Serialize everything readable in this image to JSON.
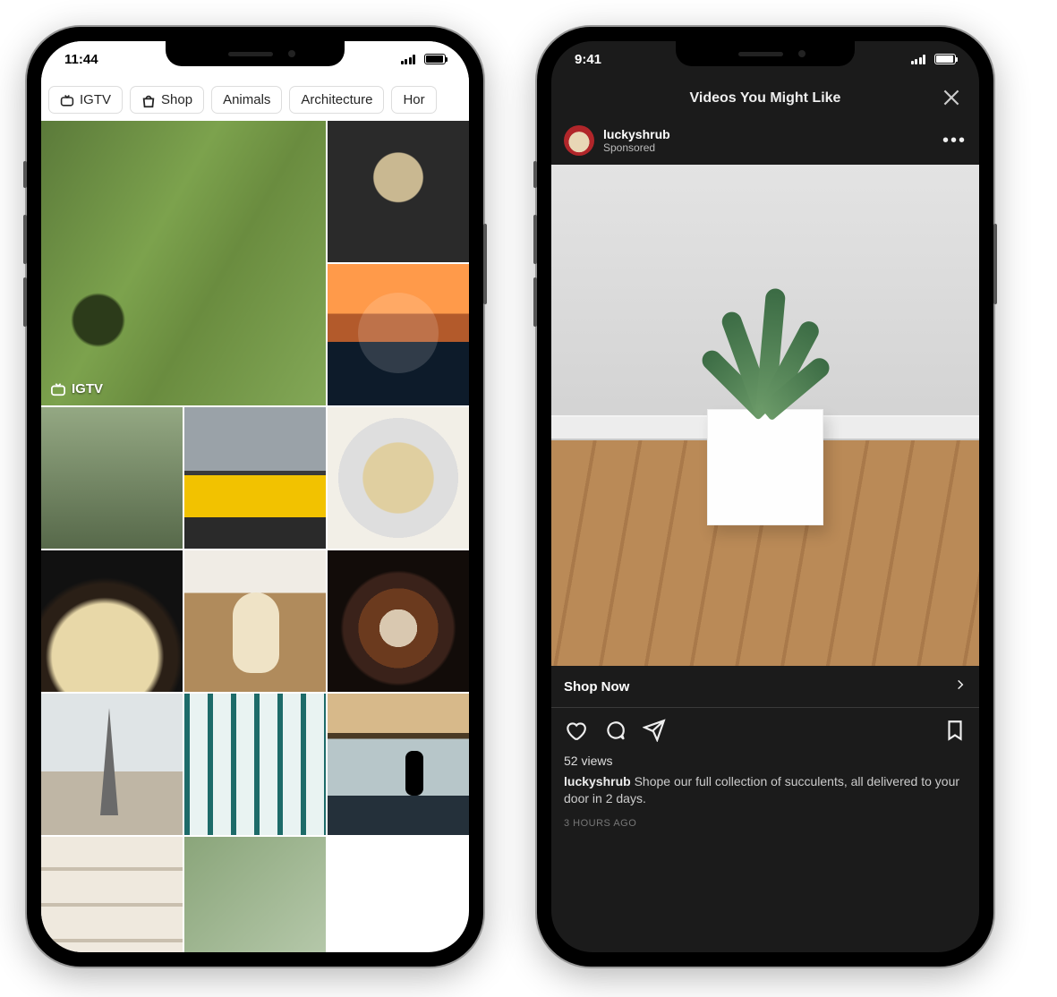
{
  "phone_explore": {
    "status_time": "11:44",
    "chips": [
      {
        "label": "IGTV",
        "icon": "igtv"
      },
      {
        "label": "Shop",
        "icon": "shop"
      },
      {
        "label": "Animals"
      },
      {
        "label": "Architecture"
      },
      {
        "label": "Hor"
      }
    ],
    "featured_badge": "IGTV",
    "tiles": [
      {
        "name": "tile-forest",
        "big": true,
        "art": "t-forest",
        "badge": true
      },
      {
        "name": "tile-food-bowl",
        "art": "t-food1"
      },
      {
        "name": "tile-sunset",
        "art": "t-sunset"
      },
      {
        "name": "tile-house",
        "art": "t-house"
      },
      {
        "name": "tile-yellow-car",
        "art": "t-car"
      },
      {
        "name": "tile-corn",
        "art": "t-corn"
      },
      {
        "name": "tile-noodles",
        "art": "t-noodle"
      },
      {
        "name": "tile-dog",
        "art": "t-dog"
      },
      {
        "name": "tile-latte",
        "art": "t-coffee"
      },
      {
        "name": "tile-eiffel",
        "art": "t-eiffel"
      },
      {
        "name": "tile-building",
        "art": "t-bldg"
      },
      {
        "name": "tile-surfer",
        "art": "t-surf"
      },
      {
        "name": "tile-shelf",
        "art": "t-shelf"
      },
      {
        "name": "tile-greenery",
        "art": "t-green2"
      }
    ]
  },
  "phone_post": {
    "status_time": "9:41",
    "header_title": "Videos You Might Like",
    "user": {
      "name": "luckyshrub",
      "sub": "Sponsored"
    },
    "cta_label": "Shop Now",
    "views_text": "52 views",
    "caption_user": "luckyshrub",
    "caption_text": " Shope our full collection of succulents, all delivered to your door in 2 days.",
    "timestamp": "3 HOURS AGO"
  }
}
